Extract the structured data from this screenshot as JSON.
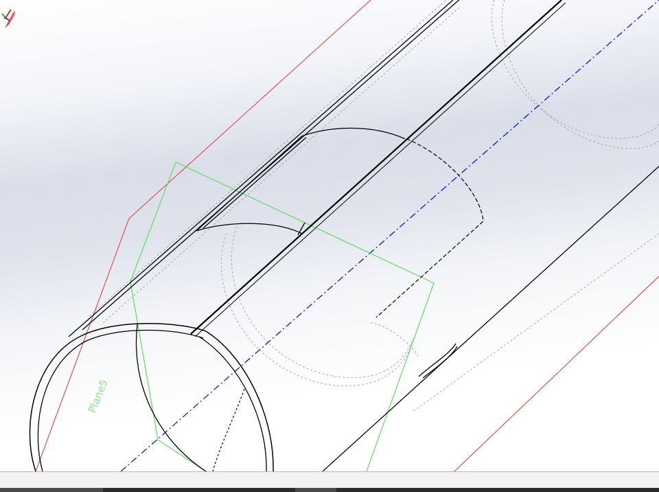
{
  "viewport": {
    "plane_label": "Plane5"
  },
  "colors": {
    "edge": "#000000",
    "hidden_edge": "#a9a9a9",
    "axis": "#0000d8",
    "plane_selected": "#5ede5a",
    "plane_reference": "#e8302a",
    "triad_x": "#d61f1f",
    "triad_y": "#2da834",
    "triad_z": "#2b48d6"
  },
  "icons": {
    "triad": "view-orientation-triad-icon",
    "right_marker": "reference-marker-icon"
  }
}
